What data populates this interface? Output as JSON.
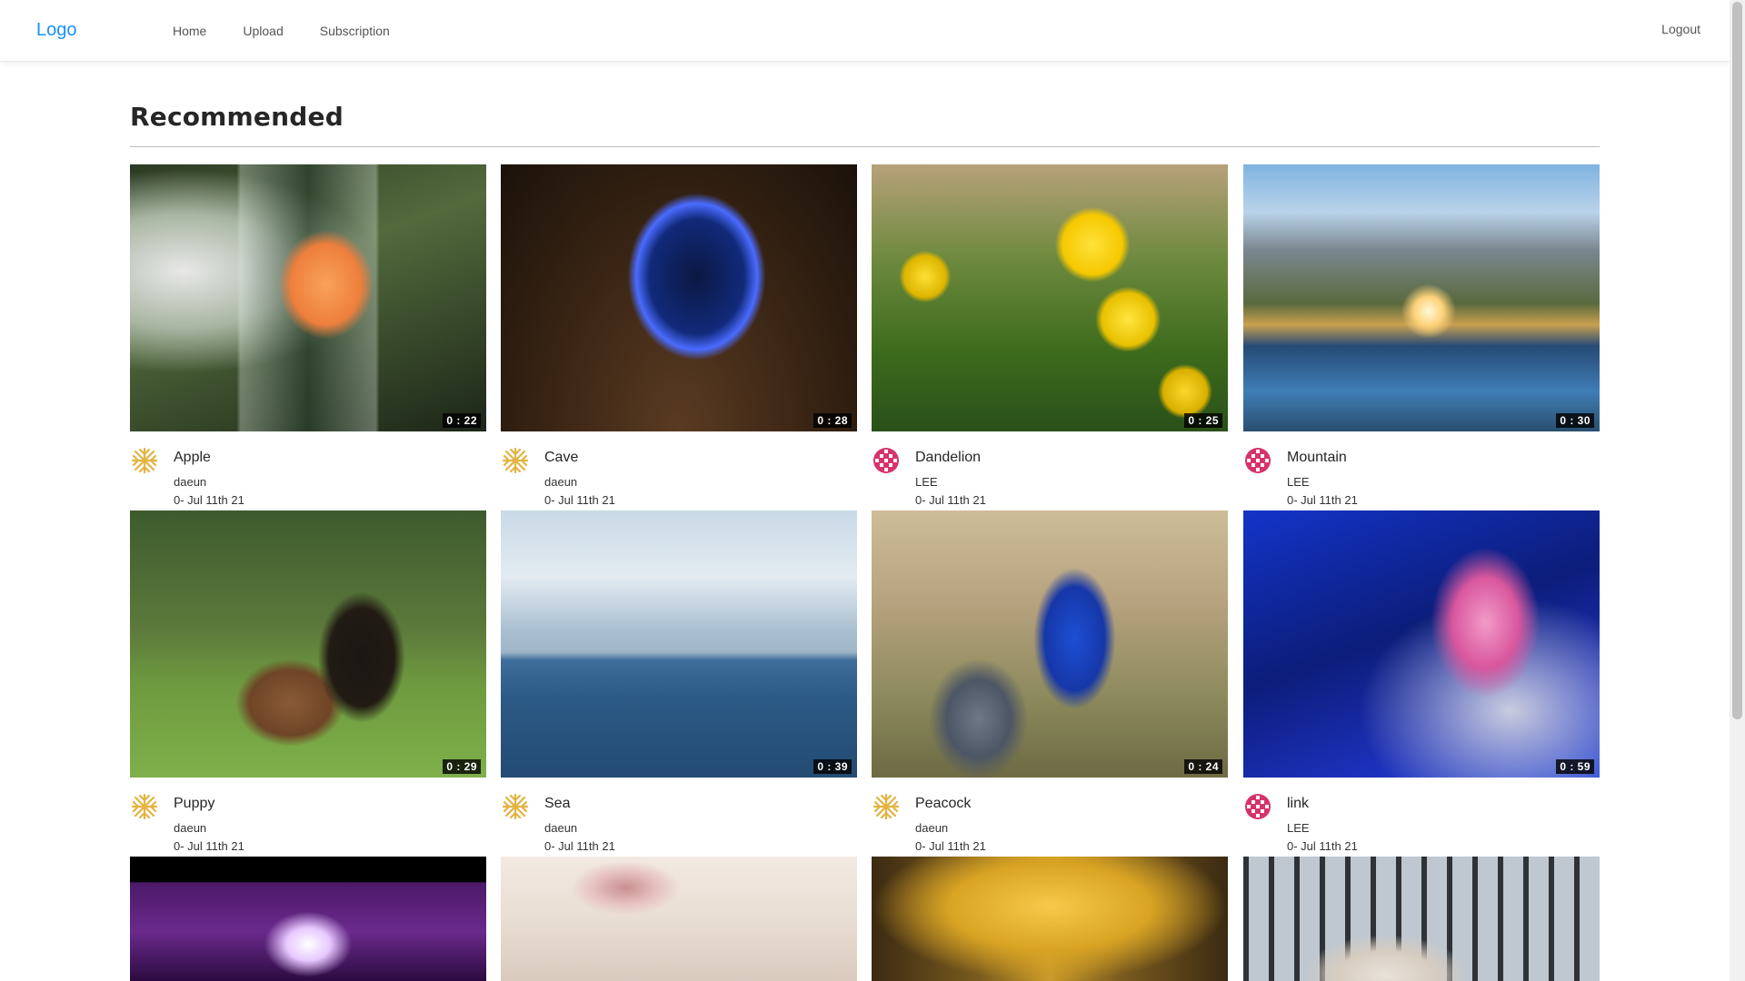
{
  "nav": {
    "logo": "Logo",
    "menu": [
      "Home",
      "Upload",
      "Subscription"
    ],
    "logout": "Logout"
  },
  "page": {
    "title": "Recommended"
  },
  "videos": [
    {
      "title": "Apple",
      "author": "daeun",
      "date": "0- Jul 11th 21",
      "duration": "0 : 22",
      "avatar_color": "#e3b341",
      "avatar_icon": "snowflake-avatar-icon"
    },
    {
      "title": "Cave",
      "author": "daeun",
      "date": "0- Jul 11th 21",
      "duration": "0 : 28",
      "avatar_color": "#e3b341",
      "avatar_icon": "snowflake-avatar-icon"
    },
    {
      "title": "Dandelion",
      "author": "LEE",
      "date": "0- Jul 11th 21",
      "duration": "0 : 25",
      "avatar_color": "#d6336c",
      "avatar_icon": "pattern-avatar-icon"
    },
    {
      "title": "Mountain",
      "author": "LEE",
      "date": "0- Jul 11th 21",
      "duration": "0 : 30",
      "avatar_color": "#d6336c",
      "avatar_icon": "pattern-avatar-icon"
    },
    {
      "title": "Puppy",
      "author": "daeun",
      "date": "0- Jul 11th 21",
      "duration": "0 : 29",
      "avatar_color": "#e3b341",
      "avatar_icon": "snowflake-avatar-icon"
    },
    {
      "title": "Sea",
      "author": "daeun",
      "date": "0- Jul 11th 21",
      "duration": "0 : 39",
      "avatar_color": "#e3b341",
      "avatar_icon": "snowflake-avatar-icon"
    },
    {
      "title": "Peacock",
      "author": "daeun",
      "date": "0- Jul 11th 21",
      "duration": "0 : 24",
      "avatar_color": "#e3b341",
      "avatar_icon": "snowflake-avatar-icon"
    },
    {
      "title": "link",
      "author": "LEE",
      "date": "0- Jul 11th 21",
      "duration": "0 : 59",
      "avatar_color": "#d6336c",
      "avatar_icon": "pattern-avatar-icon"
    }
  ],
  "colors": {
    "brand": "#1890ff",
    "text": "#262626",
    "divider": "#bdbdbd"
  }
}
